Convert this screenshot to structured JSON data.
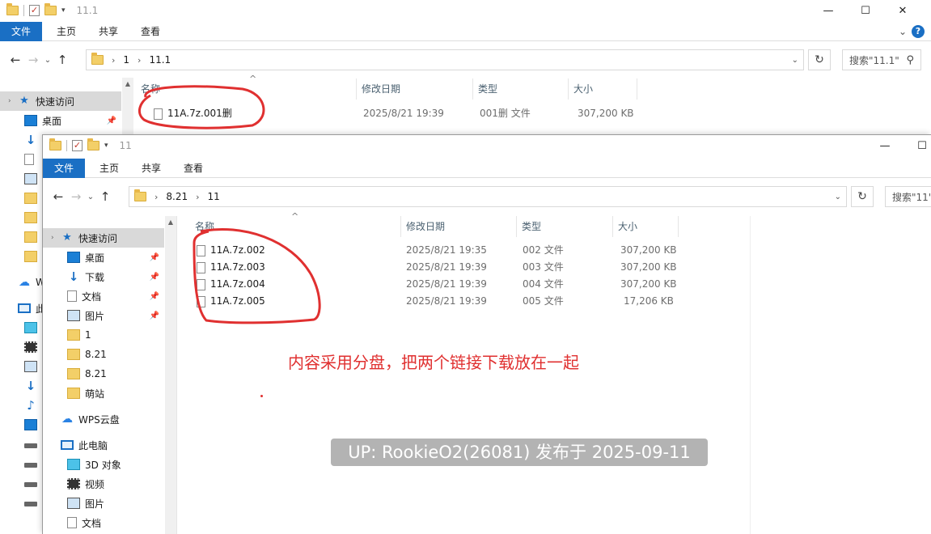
{
  "back_window": {
    "title": "11.1",
    "ribbon_tabs": [
      "文件",
      "主页",
      "共享",
      "查看"
    ],
    "breadcrumb": [
      "1",
      "11.1"
    ],
    "search_placeholder": "搜索\"11.1\"",
    "columns": [
      "名称",
      "修改日期",
      "类型",
      "大小"
    ],
    "nav": {
      "quick_access": "快速访问",
      "desktop": "桌面",
      "wps_partial": "W",
      "pc_partial": "此"
    },
    "files": [
      {
        "name": "11A.7z.001删",
        "modified": "2025/8/21 19:39",
        "type": "001删 文件",
        "size": "307,200 KB"
      }
    ]
  },
  "front_window": {
    "title": "11",
    "ribbon_tabs": [
      "文件",
      "主页",
      "共享",
      "查看"
    ],
    "breadcrumb": [
      "8.21",
      "11"
    ],
    "search_placeholder": "搜索\"11\"",
    "columns": [
      "名称",
      "修改日期",
      "类型",
      "大小"
    ],
    "nav": {
      "quick_access": "快速访问",
      "desktop": "桌面",
      "downloads": "下载",
      "documents": "文档",
      "pictures": "图片",
      "folder_1": "1",
      "folder_821a": "8.21",
      "folder_821b": "8.21",
      "folder_mengzhan": "萌站",
      "wps": "WPS云盘",
      "this_pc": "此电脑",
      "objects3d": "3D 对象",
      "videos": "视频",
      "pictures2": "图片",
      "documents2": "文档"
    },
    "files": [
      {
        "name": "11A.7z.002",
        "modified": "2025/8/21 19:35",
        "type": "002 文件",
        "size": "307,200 KB"
      },
      {
        "name": "11A.7z.003",
        "modified": "2025/8/21 19:39",
        "type": "003 文件",
        "size": "307,200 KB"
      },
      {
        "name": "11A.7z.004",
        "modified": "2025/8/21 19:39",
        "type": "004 文件",
        "size": "307,200 KB"
      },
      {
        "name": "11A.7z.005",
        "modified": "2025/8/21 19:39",
        "type": "005 文件",
        "size": "17,206 KB"
      }
    ]
  },
  "annotation": "内容采用分盘，把两个链接下载放在一起",
  "watermark": "UP: RookieO2(26081) 发布于 2025-09-11",
  "colors": {
    "accent": "#1a6fc4",
    "annotation_red": "#e03030"
  },
  "icons": [
    "folder-icon",
    "properties-check-icon",
    "back-arrow-icon",
    "forward-arrow-icon",
    "up-arrow-icon",
    "refresh-icon",
    "search-icon",
    "help-icon",
    "pin-icon",
    "file-icon"
  ]
}
